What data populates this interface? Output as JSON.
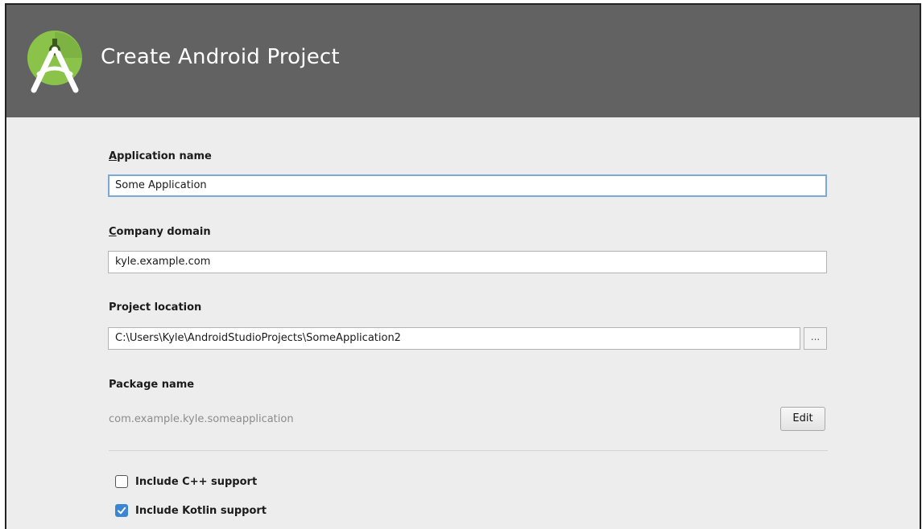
{
  "window": {
    "title": "Create Android Project"
  },
  "form": {
    "app_name": {
      "label_mnemonic": "A",
      "label_rest": "pplication name",
      "value": "Some Application"
    },
    "company_domain": {
      "label_mnemonic": "C",
      "label_rest": "ompany domain",
      "value": "kyle.example.com"
    },
    "project_location": {
      "label": "Project location",
      "value": "C:\\Users\\Kyle\\AndroidStudioProjects\\SomeApplication2",
      "browse_label": "..."
    },
    "package_name": {
      "label": "Package name",
      "value": "com.example.kyle.someapplication",
      "edit_label": "Edit"
    },
    "include_cpp": {
      "label": "Include C++ support",
      "checked": false
    },
    "include_kotlin": {
      "label": "Include Kotlin support",
      "checked": true
    }
  },
  "colors": {
    "header_bg": "#626262",
    "content_bg": "#ededed",
    "focus_border": "#7aa9d6",
    "checkbox_accent": "#3b86d4",
    "logo_green": "#8bc34a"
  },
  "icons": {
    "logo": "android-studio-logo-icon",
    "check": "checkmark-icon"
  }
}
